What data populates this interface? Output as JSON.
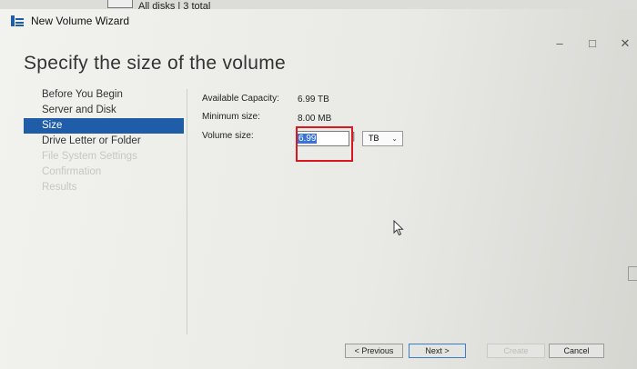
{
  "background_window": {
    "header_text": "All disks | 3 total"
  },
  "window": {
    "title": "New Volume Wizard",
    "controls": {
      "minimize": "–",
      "maximize": "□",
      "close": "✕"
    }
  },
  "page": {
    "title": "Specify the size of the volume"
  },
  "steps": [
    {
      "label": "Before You Begin",
      "state": "normal"
    },
    {
      "label": "Server and Disk",
      "state": "normal"
    },
    {
      "label": "Size",
      "state": "active"
    },
    {
      "label": "Drive Letter or Folder",
      "state": "normal"
    },
    {
      "label": "File System Settings",
      "state": "disabled"
    },
    {
      "label": "Confirmation",
      "state": "disabled"
    },
    {
      "label": "Results",
      "state": "disabled"
    }
  ],
  "fields": {
    "available_capacity": {
      "label": "Available Capacity:",
      "value": "6.99 TB"
    },
    "minimum_size": {
      "label": "Minimum size:",
      "value": "8.00 MB"
    },
    "volume_size": {
      "label": "Volume size:",
      "value": "6.99"
    },
    "unit_select": {
      "value": "TB",
      "icon": "chevron-down-icon"
    }
  },
  "buttons": {
    "previous": "< Previous",
    "next": "Next >",
    "create": "Create",
    "cancel": "Cancel"
  },
  "colors": {
    "active_step": "#1f5da9",
    "highlight": "#d9191f",
    "selection": "#3a73d6"
  }
}
